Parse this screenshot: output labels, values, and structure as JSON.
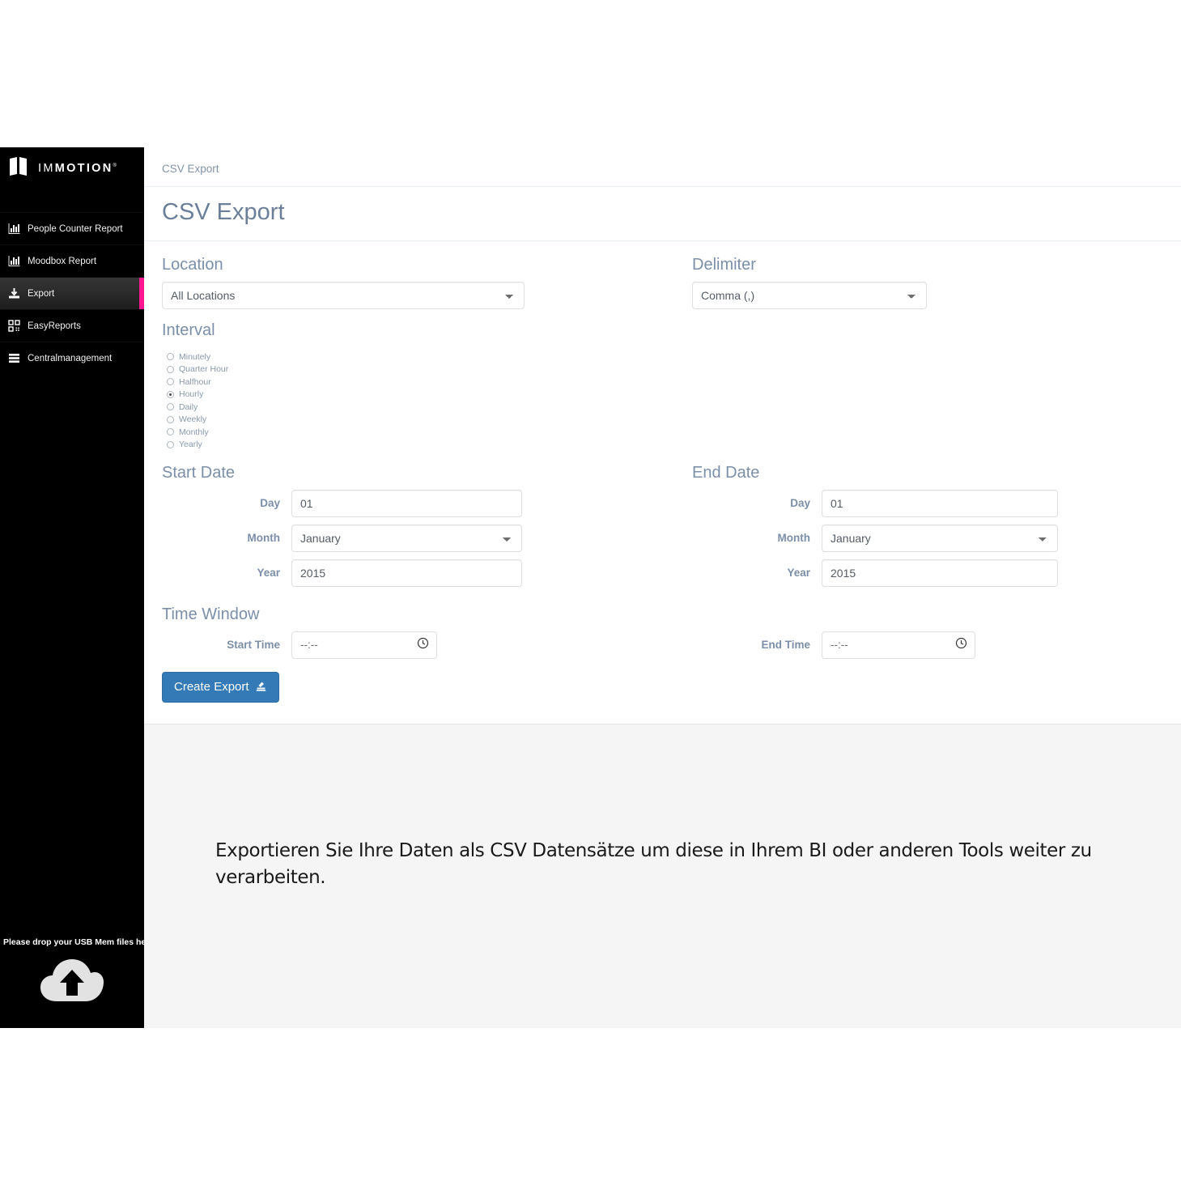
{
  "sidebar": {
    "logo": {
      "light": "IM",
      "bold": "MOTION",
      "mark": "®"
    },
    "items": [
      {
        "label": "People Counter Report",
        "icon": "bar-chart-icon",
        "active": false
      },
      {
        "label": "Moodbox Report",
        "icon": "bar-chart-icon",
        "active": false
      },
      {
        "label": "Export",
        "icon": "download-icon",
        "active": true
      },
      {
        "label": "EasyReports",
        "icon": "grid-icon",
        "active": false
      },
      {
        "label": "Centralmanagement",
        "icon": "server-list-icon",
        "active": false
      }
    ],
    "usb_drop": {
      "text": "Please drop your USB Mem files here",
      "icon": "cloud-upload-icon"
    },
    "accent_color": "#ff1493",
    "background": "#000000"
  },
  "breadcrumb": "CSV Export",
  "page_title": "CSV Export",
  "form": {
    "location": {
      "label": "Location",
      "value": "All Locations",
      "options": [
        "All Locations"
      ]
    },
    "delimiter": {
      "label": "Delimiter",
      "value": "Comma (,)",
      "options": [
        "Comma (,)"
      ]
    },
    "interval": {
      "label": "Interval",
      "selected": "Hourly",
      "options": [
        "Minutely",
        "Quarter Hour",
        "Halfhour",
        "Hourly",
        "Daily",
        "Weekly",
        "Monthly",
        "Yearly"
      ]
    },
    "start_date": {
      "label": "Start Date",
      "day_label": "Day",
      "day_value": "01",
      "month_label": "Month",
      "month_value": "January",
      "month_options": [
        "January"
      ],
      "year_label": "Year",
      "year_value": "2015"
    },
    "end_date": {
      "label": "End Date",
      "day_label": "Day",
      "day_value": "01",
      "month_label": "Month",
      "month_value": "January",
      "month_options": [
        "January"
      ],
      "year_label": "Year",
      "year_value": "2015"
    },
    "time_window": {
      "label": "Time Window",
      "start_time_label": "Start Time",
      "start_time_value": "--:--",
      "end_time_label": "End Time",
      "end_time_value": "--:--",
      "clock_icon": "clock-icon"
    },
    "submit": {
      "label": "Create Export",
      "icon": "export-icon",
      "color": "#337ab7"
    }
  },
  "description": "Exportieren Sie Ihre Daten als CSV Datensätze um diese in Ihrem BI  oder anderen Tools weiter zu verarbeiten."
}
